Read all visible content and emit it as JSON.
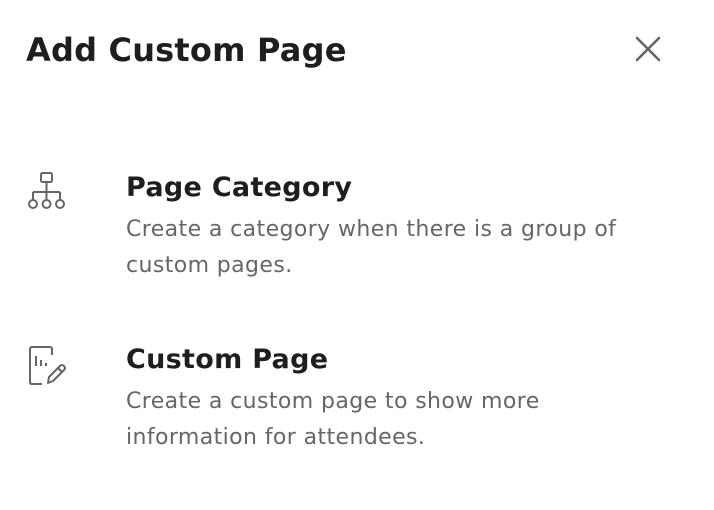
{
  "dialog": {
    "title": "Add Custom Page",
    "close_icon": "close-icon"
  },
  "options": [
    {
      "icon": "sitemap-icon",
      "title": "Page Category",
      "description": "Create a category when there is a group of custom pages."
    },
    {
      "icon": "document-edit-icon",
      "title": "Custom Page",
      "description": "Create a custom page to show more information for attendees."
    }
  ],
  "colors": {
    "title_text": "#1e1e1e",
    "description_text": "#666666",
    "icon_stroke": "#666666",
    "background": "#ffffff"
  }
}
